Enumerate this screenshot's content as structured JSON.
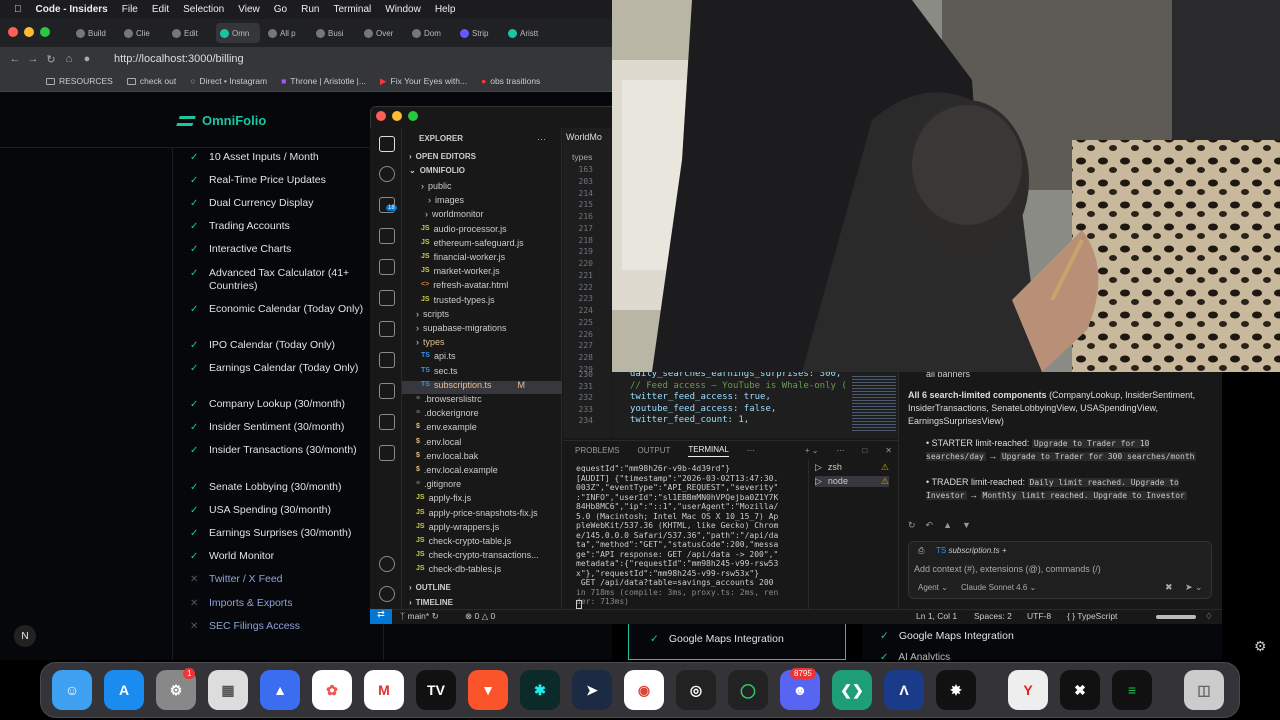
{
  "menubar": {
    "app": "Code - Insiders",
    "items": [
      "File",
      "Edit",
      "Selection",
      "View",
      "Go",
      "Run",
      "Terminal",
      "Window",
      "Help"
    ]
  },
  "browser": {
    "tabs": [
      "Build",
      "Clie",
      "Edit",
      "Omn",
      "All p",
      "Busi",
      "Over",
      "Dom",
      "Strip",
      "Aristt"
    ],
    "url": "http://localhost:3000/billing",
    "bookmarks": [
      "RESOURCES",
      "check out",
      "Direct • Instagram",
      "Throne | Aristotle |...",
      "Fix Your Eyes with...",
      "obs trasitions"
    ]
  },
  "page": {
    "brand": "OmniFolio",
    "features": [
      {
        "label": "10 Asset Inputs / Month",
        "on": true
      },
      {
        "label": "Real-Time Price Updates",
        "on": true
      },
      {
        "label": "Dual Currency Display",
        "on": true
      },
      {
        "label": "Trading Accounts",
        "on": true
      },
      {
        "label": "Interactive Charts",
        "on": true
      },
      {
        "label": "Advanced Tax Calculator (41+ Countries)",
        "on": true
      },
      {
        "label": "Economic Calendar (Today Only)",
        "on": true
      },
      {
        "label": "IPO Calendar (Today Only)",
        "on": true
      },
      {
        "label": "Earnings Calendar (Today Only)",
        "on": true
      },
      {
        "label": "Company Lookup (30/month)",
        "on": true
      },
      {
        "label": "Insider Sentiment (30/month)",
        "on": true
      },
      {
        "label": "Insider Transactions (30/month)",
        "on": true
      },
      {
        "label": "Senate Lobbying (30/month)",
        "on": true
      },
      {
        "label": "USA Spending (30/month)",
        "on": true
      },
      {
        "label": "Earnings Surprises (30/month)",
        "on": true
      },
      {
        "label": "World Monitor",
        "on": true
      },
      {
        "label": "Twitter / X Feed",
        "on": false
      },
      {
        "label": "Imports & Exports",
        "on": false
      },
      {
        "label": "SEC Filings Access",
        "on": false
      }
    ],
    "behind": {
      "left_item": "Google Maps Integration",
      "right_item": "Google Maps Integration",
      "right_item2": "AI Analytics"
    }
  },
  "vscode": {
    "explorer_title": "EXPLORER",
    "sections": {
      "open_editors": "OPEN EDITORS",
      "project": "OMNIFOLIO",
      "outline": "OUTLINE",
      "timeline": "TIMELINE"
    },
    "tree": [
      {
        "name": "public",
        "type": "folder"
      },
      {
        "name": "images",
        "type": "folder"
      },
      {
        "name": "worldmonitor",
        "type": "folder"
      },
      {
        "name": "audio-processor.js",
        "type": "js"
      },
      {
        "name": "ethereum-safeguard.js",
        "type": "js"
      },
      {
        "name": "financial-worker.js",
        "type": "js"
      },
      {
        "name": "market-worker.js",
        "type": "js"
      },
      {
        "name": "refresh-avatar.html",
        "type": "html"
      },
      {
        "name": "trusted-types.js",
        "type": "js"
      },
      {
        "name": "scripts",
        "type": "folder"
      },
      {
        "name": "supabase-migrations",
        "type": "folder"
      },
      {
        "name": "types",
        "type": "folder"
      },
      {
        "name": "api.ts",
        "type": "ts"
      },
      {
        "name": "sec.ts",
        "type": "ts"
      },
      {
        "name": "subscription.ts",
        "type": "ts",
        "badge": "M"
      },
      {
        "name": ".browserslistrc",
        "type": "file"
      },
      {
        "name": ".dockerignore",
        "type": "file"
      },
      {
        "name": ".env.example",
        "type": "env"
      },
      {
        "name": ".env.local",
        "type": "env"
      },
      {
        "name": ".env.local.bak",
        "type": "env"
      },
      {
        "name": ".env.local.example",
        "type": "env"
      },
      {
        "name": ".gitignore",
        "type": "file"
      },
      {
        "name": "apply-fix.js",
        "type": "js"
      },
      {
        "name": "apply-price-snapshots-fix.js",
        "type": "js"
      },
      {
        "name": "apply-wrappers.js",
        "type": "js"
      },
      {
        "name": "check-crypto-table.js",
        "type": "js"
      },
      {
        "name": "check-crypto-transactions...",
        "type": "js"
      },
      {
        "name": "check-db-tables.js",
        "type": "js"
      }
    ],
    "editor_tab": "WorldMo",
    "breadcrumb": "types",
    "line_numbers": [
      "163",
      "203",
      "214",
      "215",
      "216",
      "217",
      "218",
      "219",
      "220",
      "221",
      "222",
      "223",
      "224",
      "225",
      "226",
      "227",
      "228",
      "229"
    ],
    "code_lines": [
      {
        "ln": "230",
        "text": "daily_searches_earnings_surprises: 300,"
      },
      {
        "ln": "231",
        "text": "// Feed access — YouTube is Whale-only ("
      },
      {
        "ln": "232",
        "text": "twitter_feed_access: true,"
      },
      {
        "ln": "233",
        "text": "youtube_feed_access: false,"
      },
      {
        "ln": "234",
        "text": "twitter_feed_count: 1,"
      }
    ],
    "panel_tabs": [
      "PROBLEMS",
      "OUTPUT",
      "TERMINAL"
    ],
    "terminal_lines": [
      "equestId\":\"mm98h26r-v9b-4d39rd\"}",
      "[AUDIT] {\"timestamp\":\"2026-03-02T13:47:30.",
      "003Z\",\"eventType\":\"API_REQUEST\",\"severity\"",
      ":\"INFO\",\"userId\":\"sl1EBBmMN0hVPQejba0Z1Y7K",
      "84Hb8MC6\",\"ip\":\"::1\",\"userAgent\":\"Mozilla/",
      "5.0 (Macintosh; Intel Mac OS X 10_15_7) Ap",
      "pleWebKit/537.36 (KHTML, like Gecko) Chrom",
      "e/145.0.0.0 Safari/537.36\",\"path\":\"/api/da",
      "ta\",\"method\":\"GET\",\"statusCode\":200,\"messa",
      "ge\":\"API response: GET /api/data -> 200\",\"",
      "metadata\":{\"requestId\":\"mm98h245-v99-rsw53",
      "x\"},\"requestId\":\"mm98h245-v99-rsw53x\"}",
      " GET /api/data?table=savings_accounts 200",
      "in 718ms (compile: 3ms, proxy.ts: 2ms, ren",
      "der: 713ms)"
    ],
    "terminals": [
      {
        "name": "zsh"
      },
      {
        "name": "node"
      }
    ],
    "chat": {
      "top": "all banners",
      "heading_bold": "All 6 search-limited components",
      "heading_rest": "(CompanyLookup, InsiderSentiment, InsiderTransactions, SenateLobbyingView, USASpendingView, EarningsSurprisesView)",
      "bullet1_label": "STARTER limit-reached:",
      "bullet1_from": "Upgrade to Trader for 10 searches/day",
      "bullet1_to": "Upgrade to Trader for 300 searches/month",
      "bullet2_label": "TRADER limit-reached:",
      "bullet2_from": "Daily limit reached. Upgrade to Investor",
      "bullet2_to": "Monthly limit reached. Upgrade to Investor",
      "context_file": "subscription.ts",
      "placeholder": "Add context (#), extensions (@), commands (/)",
      "mode": "Agent",
      "model": "Claude Sonnet 4.6"
    },
    "status": {
      "branch": "main*",
      "errors": "0",
      "warnings": "0",
      "position": "Ln 1, Col 1",
      "spaces": "Spaces: 2",
      "encoding": "UTF-8",
      "language": "TypeScript"
    }
  },
  "dock": {
    "system_settings_badge": "1",
    "discord_badge": "8795"
  },
  "colors": {
    "accent": "#19c6a1",
    "vscode_blue": "#0078d4"
  }
}
